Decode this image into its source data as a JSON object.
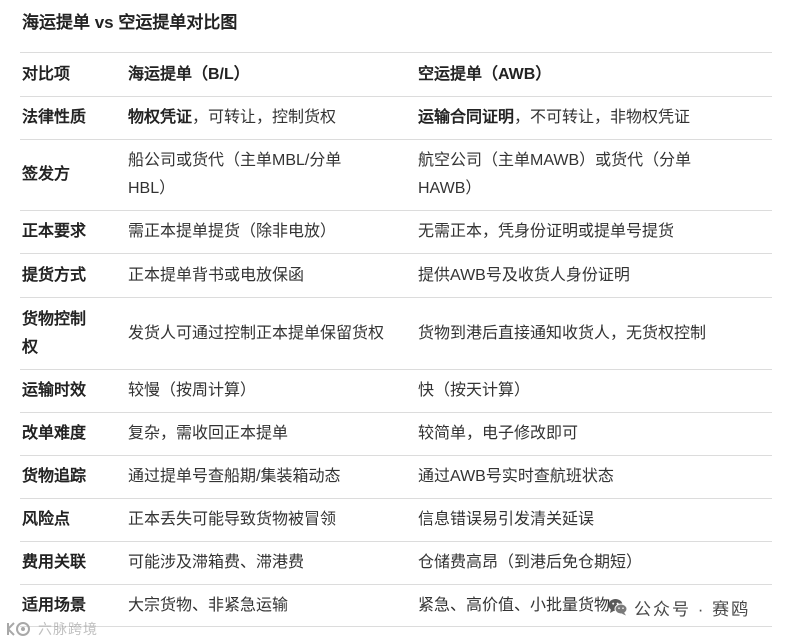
{
  "title": "海运提单 vs 空运提单对比图",
  "table": {
    "header": {
      "item": "对比项",
      "sea": "海运提单（B/L）",
      "air": "空运提单（AWB）"
    },
    "rows": [
      {
        "item": "法律性质",
        "sea": {
          "bold": "物权凭证",
          "text": "，可转让，控制货权"
        },
        "air": {
          "bold": "运输合同证明",
          "text": "，不可转让，非物权凭证"
        }
      },
      {
        "item": "签发方",
        "sea": [
          "船公司或货代（主单MBL/分单",
          "HBL）"
        ],
        "air": [
          "航空公司（主单MAWB）或货代（分单",
          "HAWB）"
        ]
      },
      {
        "item": "正本要求",
        "sea": "需正本提单提货（除非电放）",
        "air": "无需正本，凭身份证明或提单号提货"
      },
      {
        "item": "提货方式",
        "sea": "正本提单背书或电放保函",
        "air": "提供AWB号及收货人身份证明"
      },
      {
        "item": [
          "货物控制",
          "权"
        ],
        "sea": "发货人可通过控制正本提单保留货权",
        "air": "货物到港后直接通知收货人，无货权控制"
      },
      {
        "item": "运输时效",
        "sea": "较慢（按周计算）",
        "air": "快（按天计算）"
      },
      {
        "item": "改单难度",
        "sea": "复杂，需收回正本提单",
        "air": "较简单，电子修改即可"
      },
      {
        "item": "货物追踪",
        "sea": "通过提单号查船期/集装箱动态",
        "air": "通过AWB号实时查航班状态"
      },
      {
        "item": "风险点",
        "sea": "正本丢失可能导致货物被冒领",
        "air": "信息错误易引发清关延误"
      },
      {
        "item": "费用关联",
        "sea": "可能涉及滞箱费、滞港费",
        "air": "仓储费高昂（到港后免仓期短）"
      },
      {
        "item": "适用场景",
        "sea": "大宗货物、非紧急运输",
        "air": "紧急、高价值、小批量货物"
      }
    ]
  },
  "watermarks": {
    "wechat": "公众号 · 赛鸥",
    "wechat_icon": "wechat-icon",
    "brand": "六脉跨境",
    "brand_icon": "brand-logo-icon"
  }
}
